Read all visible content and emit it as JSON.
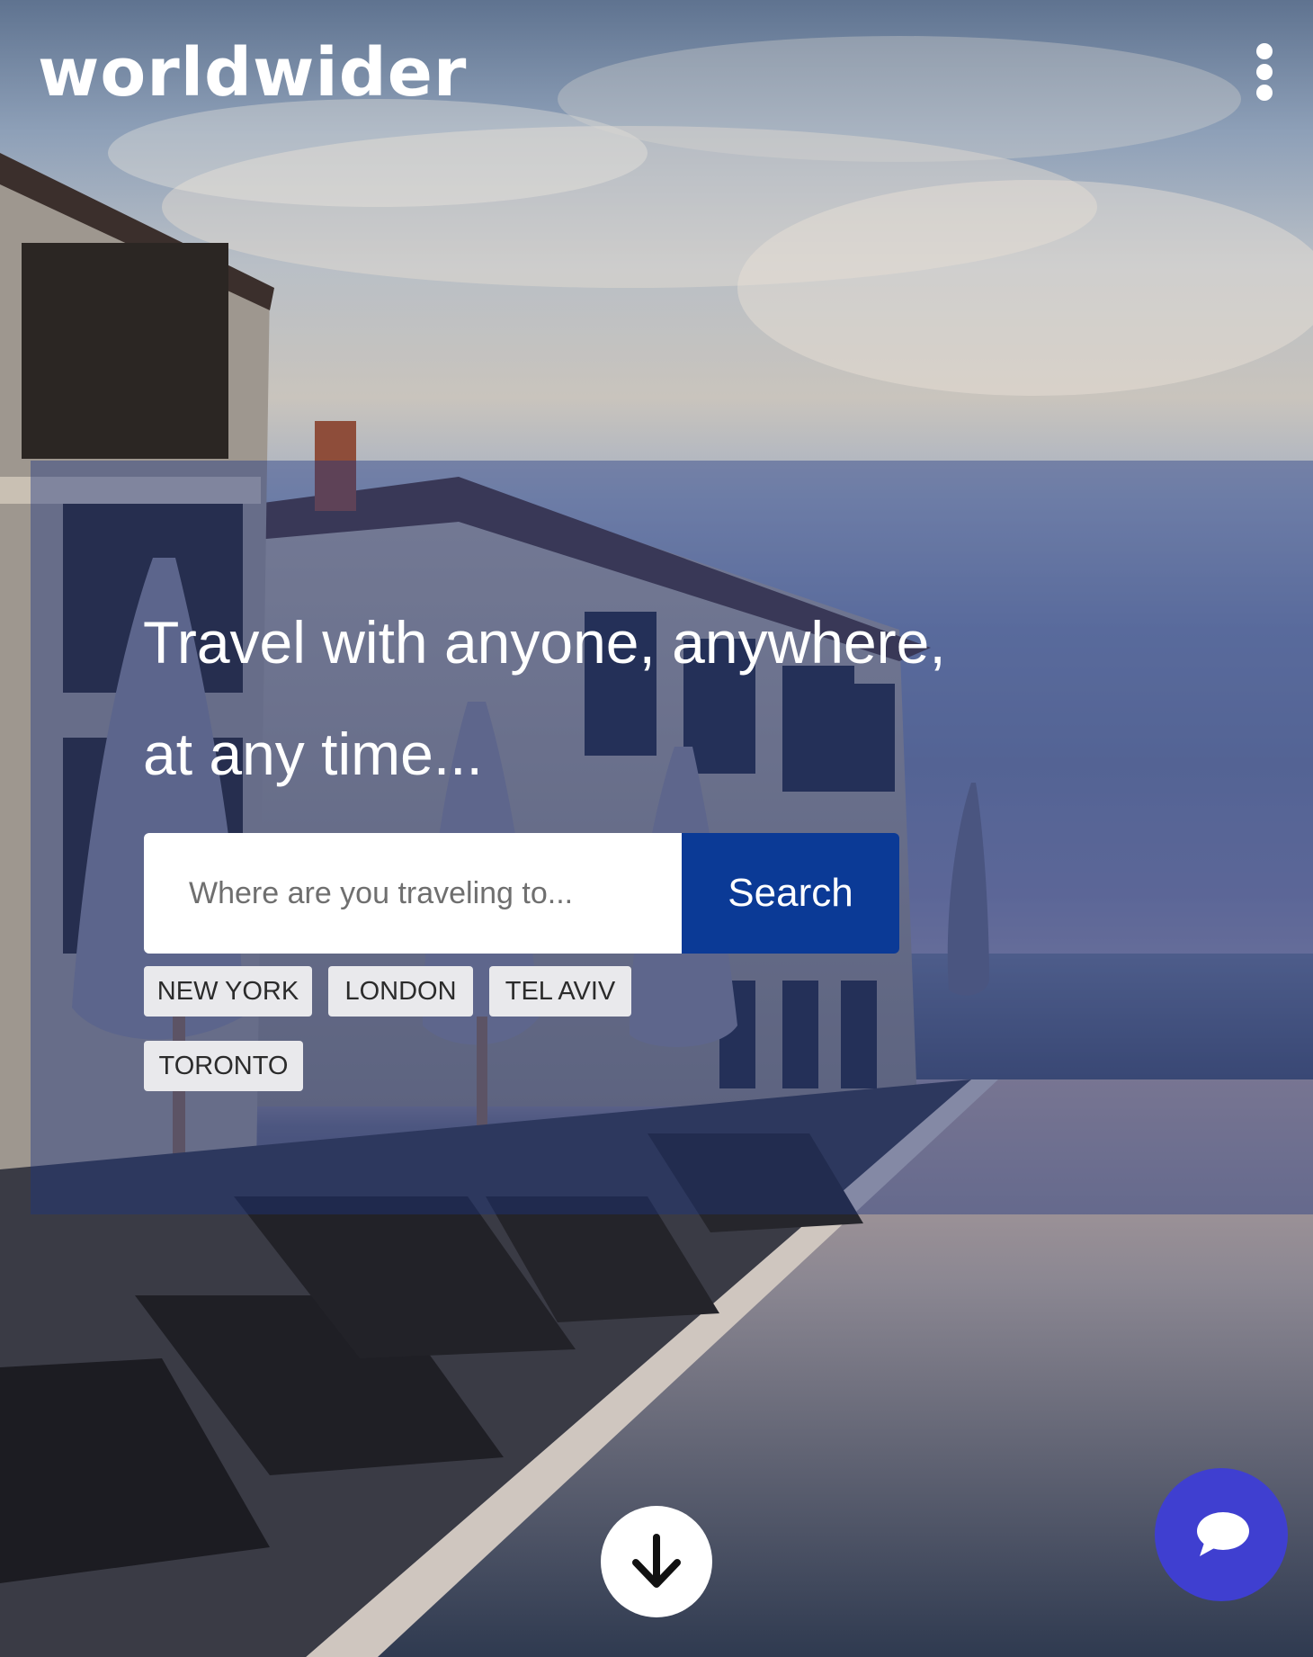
{
  "brand": {
    "name": "worldwider"
  },
  "header": {
    "menu_icon": "kebab-menu-icon"
  },
  "hero": {
    "headline_line1": "Travel with anyone, anywhere,",
    "headline_line2": "at any time..."
  },
  "search": {
    "placeholder": "Where are you traveling to...",
    "value": "",
    "button_label": "Search"
  },
  "quick_destinations": [
    "NEW YORK",
    "LONDON",
    "TEL AVIV",
    "TORONTO"
  ],
  "scroll_button": {
    "icon": "arrow-down-icon"
  },
  "chat_button": {
    "icon": "chat-bubble-icon"
  },
  "colors": {
    "brand_blue": "#0b3a96",
    "chat_button": "#3f3fd0",
    "panel_overlay": "#1d3580",
    "chip_background": "#e9e9ec"
  }
}
